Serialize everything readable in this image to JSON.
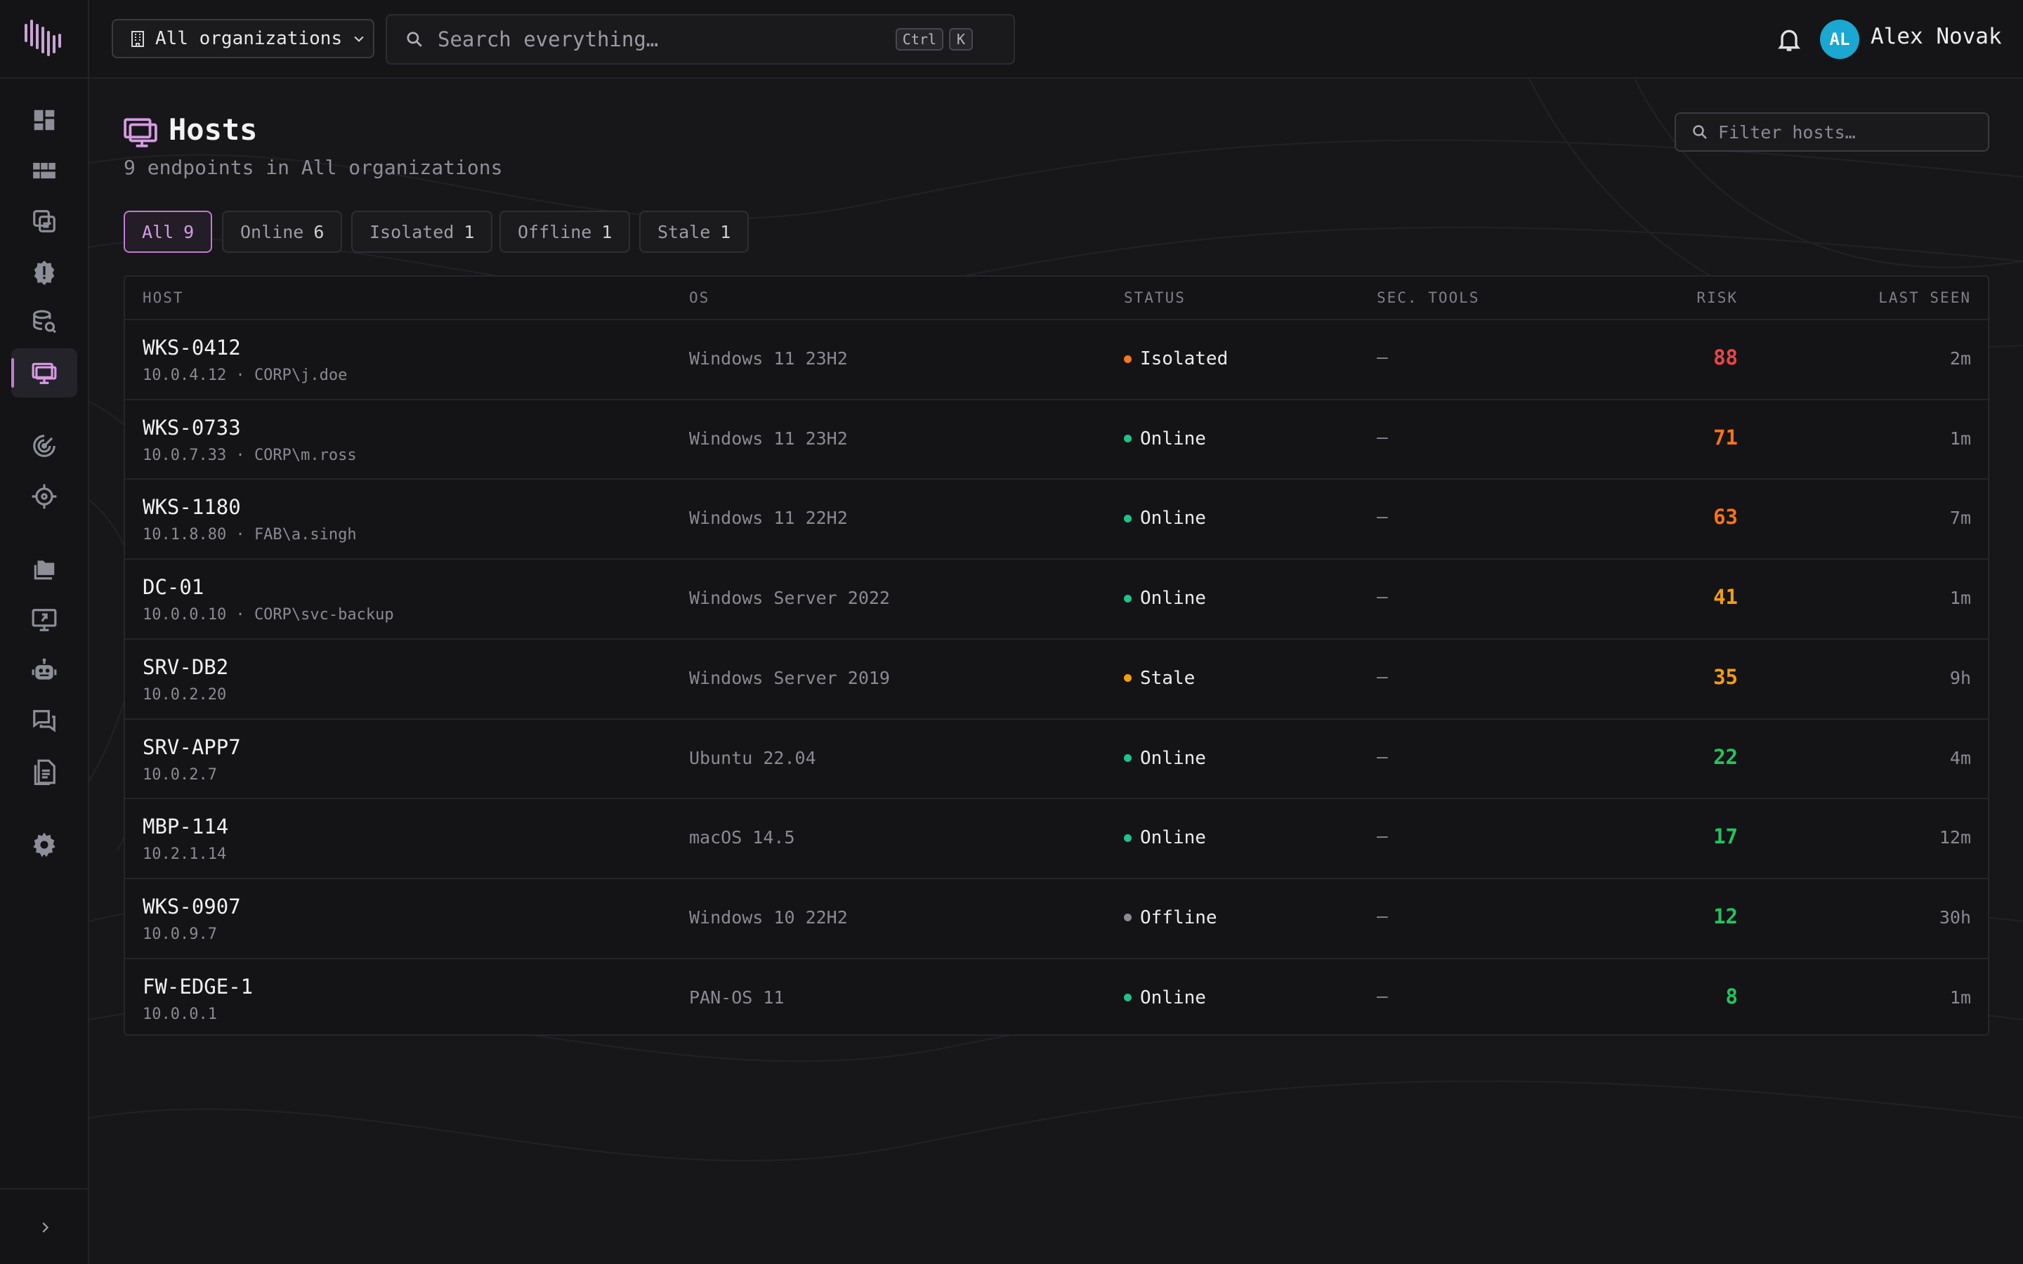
{
  "topbar": {
    "org_select": {
      "label": "All organizations"
    },
    "search": {
      "placeholder": "Search everything…",
      "kbd1": "Ctrl",
      "kbd2": "K"
    },
    "user": {
      "initials": "AL",
      "name": "Alex Novak"
    }
  },
  "sidebar": {
    "items": [
      {
        "icon": "dashboard-icon"
      },
      {
        "icon": "boards-icon"
      },
      {
        "icon": "cases-icon"
      },
      {
        "icon": "alerts-icon"
      },
      {
        "icon": "hunt-icon"
      },
      {
        "icon": "hosts-icon",
        "active": true
      },
      {
        "icon": "radar-icon"
      },
      {
        "icon": "crosshair-icon"
      },
      {
        "icon": "folders-icon"
      },
      {
        "icon": "remote-desktop-icon"
      },
      {
        "icon": "robot-icon"
      },
      {
        "icon": "chat-icon"
      },
      {
        "icon": "reports-icon"
      },
      {
        "icon": "settings-icon"
      }
    ]
  },
  "header": {
    "title": "Hosts",
    "subtitle": "9 endpoints in All organizations",
    "filter_placeholder": "Filter hosts…"
  },
  "chips": [
    {
      "label": "All",
      "count": "9",
      "active": true
    },
    {
      "label": "Online",
      "count": "6"
    },
    {
      "label": "Isolated",
      "count": "1"
    },
    {
      "label": "Offline",
      "count": "1"
    },
    {
      "label": "Stale",
      "count": "1"
    }
  ],
  "table": {
    "columns": {
      "host": "HOST",
      "os": "OS",
      "status": "STATUS",
      "sec_tools": "SEC. TOOLS",
      "risk": "RISK",
      "last_seen": "LAST SEEN"
    },
    "rows": [
      {
        "host": "WKS-0412",
        "meta": "10.0.4.12 · CORP\\j.doe",
        "os": "Windows 11 23H2",
        "status": "Isolated",
        "status_color": "#f07a22",
        "sec": "—",
        "risk": "88",
        "risk_color": "#ef4444",
        "seen": "2m"
      },
      {
        "host": "WKS-0733",
        "meta": "10.0.7.33 · CORP\\m.ross",
        "os": "Windows 11 23H2",
        "status": "Online",
        "status_color": "#1fc28a",
        "sec": "—",
        "risk": "71",
        "risk_color": "#f97316",
        "seen": "1m"
      },
      {
        "host": "WKS-1180",
        "meta": "10.1.8.80 · FAB\\a.singh",
        "os": "Windows 11 22H2",
        "status": "Online",
        "status_color": "#1fc28a",
        "sec": "—",
        "risk": "63",
        "risk_color": "#f97316",
        "seen": "7m"
      },
      {
        "host": "DC-01",
        "meta": "10.0.0.10 · CORP\\svc-backup",
        "os": "Windows Server 2022",
        "status": "Online",
        "status_color": "#1fc28a",
        "sec": "—",
        "risk": "41",
        "risk_color": "#f59e0b",
        "seen": "1m"
      },
      {
        "host": "SRV-DB2",
        "meta": "10.0.2.20",
        "os": "Windows Server 2019",
        "status": "Stale",
        "status_color": "#f59e0b",
        "sec": "—",
        "risk": "35",
        "risk_color": "#f59e0b",
        "seen": "9h"
      },
      {
        "host": "SRV-APP7",
        "meta": "10.0.2.7",
        "os": "Ubuntu 22.04",
        "status": "Online",
        "status_color": "#1fc28a",
        "sec": "—",
        "risk": "22",
        "risk_color": "#22c55e",
        "seen": "4m"
      },
      {
        "host": "MBP-114",
        "meta": "10.2.1.14",
        "os": "macOS 14.5",
        "status": "Online",
        "status_color": "#1fc28a",
        "sec": "—",
        "risk": "17",
        "risk_color": "#22c55e",
        "seen": "12m"
      },
      {
        "host": "WKS-0907",
        "meta": "10.0.9.7",
        "os": "Windows 10 22H2",
        "status": "Offline",
        "status_color": "#8b8b93",
        "sec": "—",
        "risk": "12",
        "risk_color": "#22c55e",
        "seen": "30h"
      },
      {
        "host": "FW-EDGE-1",
        "meta": "10.0.0.1",
        "os": "PAN-OS 11",
        "status": "Online",
        "status_color": "#1fc28a",
        "sec": "—",
        "risk": "8",
        "risk_color": "#22c55e",
        "seen": "1m"
      }
    ]
  },
  "colors": {
    "accent": "#c17ad0",
    "avatar": "#1aa7d1"
  }
}
